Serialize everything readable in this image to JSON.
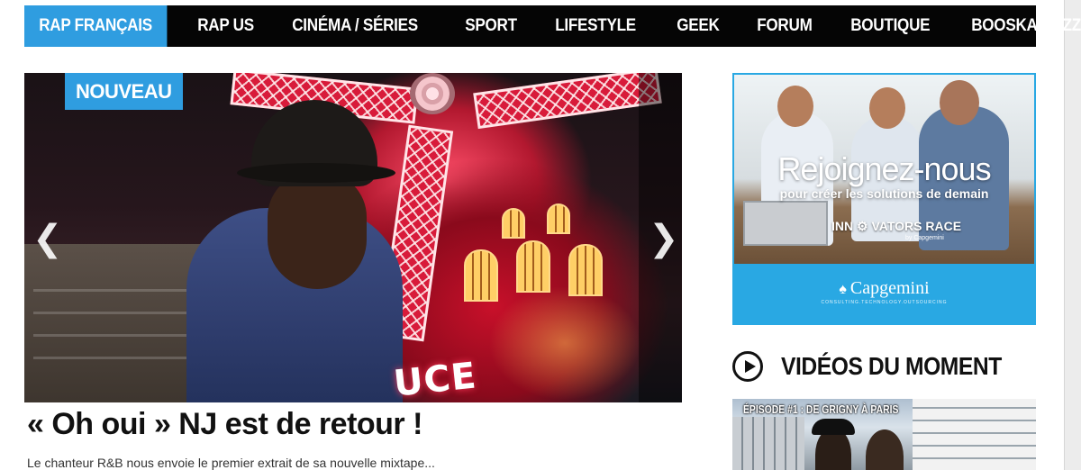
{
  "nav": {
    "items": [
      {
        "label": "RAP FRANÇAIS",
        "active": true
      },
      {
        "label": "RAP US"
      },
      {
        "label": "CINÉMA / SÉRIES"
      },
      {
        "label": "SPORT"
      },
      {
        "label": "LIFESTYLE"
      },
      {
        "label": "GEEK"
      },
      {
        "label": "FORUM"
      },
      {
        "label": "BOUTIQUE"
      },
      {
        "label": "BOOSKA'BUZZ"
      }
    ],
    "active_color": "#2f9de0",
    "background": "#050505"
  },
  "slider": {
    "badge": "NOUVEAU",
    "sign_text": "UCE",
    "prev_icon": "chevron-left-icon",
    "next_icon": "chevron-right-icon"
  },
  "article": {
    "headline": "« Oh oui » NJ est de retour !",
    "excerpt": "Le chanteur R&B nous envoie le premier extrait de sa nouvelle mixtape..."
  },
  "ad": {
    "headline": "Rejoignez-nous",
    "subline": "pour créer les solutions de demain",
    "race": "INN",
    "race_rest": "VATORS RACE",
    "race_by": "by Capgemini",
    "logo": "Capgemini",
    "logo_tagline": "CONSULTING.TECHNOLOGY.OUTSOURCING",
    "accent": "#29a8e3"
  },
  "videos": {
    "title": "VIDÉOS DU MOMENT",
    "icon": "play-circle-icon",
    "first_caption": "ÉPISODE #1 : DE GRIGNY À PARIS"
  }
}
